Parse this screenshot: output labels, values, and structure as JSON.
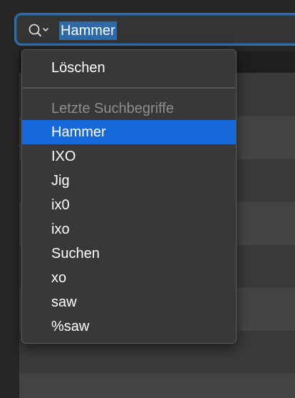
{
  "search": {
    "query": "Hammer",
    "icon": "magnifier-dropdown-icon"
  },
  "menu": {
    "clear_label": "Löschen",
    "recent_header": "Letzte Suchbegriffe",
    "recent_items": [
      "Hammer",
      "IXO",
      "Jig",
      "ix0",
      "ixo",
      "Suchen",
      "xo",
      "saw",
      "%saw"
    ],
    "selected_index": 0
  },
  "colors": {
    "accent": "#1769d9",
    "focus_ring": "#2f6fa5"
  }
}
